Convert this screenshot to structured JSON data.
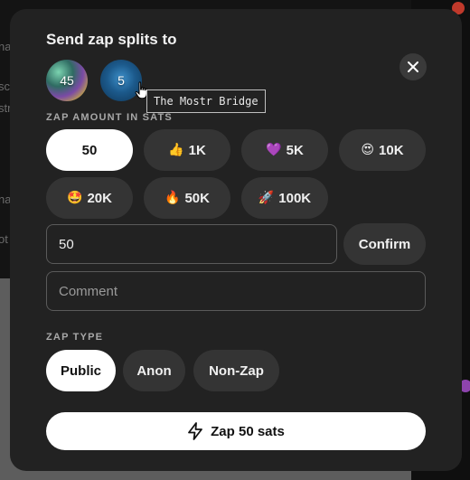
{
  "modal": {
    "title": "Send zap splits to",
    "close_icon": "close-icon"
  },
  "recipients": [
    {
      "count": "45"
    },
    {
      "count": "5",
      "tooltip": "The Mostr Bridge"
    }
  ],
  "amount_section": {
    "label": "ZAP AMOUNT IN SATS",
    "presets": [
      {
        "emoji": "",
        "label": "50",
        "selected": true
      },
      {
        "emoji": "👍",
        "label": "1K"
      },
      {
        "emoji": "💜",
        "label": "5K"
      },
      {
        "emoji": "😍",
        "label": "10K"
      },
      {
        "emoji": "🤩",
        "label": "20K"
      },
      {
        "emoji": "🔥",
        "label": "50K"
      },
      {
        "emoji": "🚀",
        "label": "100K"
      }
    ],
    "custom_value": "50",
    "confirm_label": "Confirm"
  },
  "comment": {
    "placeholder": "Comment"
  },
  "zap_type": {
    "label": "ZAP TYPE",
    "options": [
      "Public",
      "Anon",
      "Non-Zap"
    ],
    "selected": "Public"
  },
  "submit": {
    "label": "Zap 50 sats",
    "icon": "lightning-icon"
  },
  "background": {
    "edge_texts": [
      "na",
      "sc",
      "str",
      "na",
      "ot"
    ]
  },
  "colors": {
    "modal_bg": "#222222",
    "pill_bg": "#343434",
    "selected_bg": "#ffffff"
  }
}
